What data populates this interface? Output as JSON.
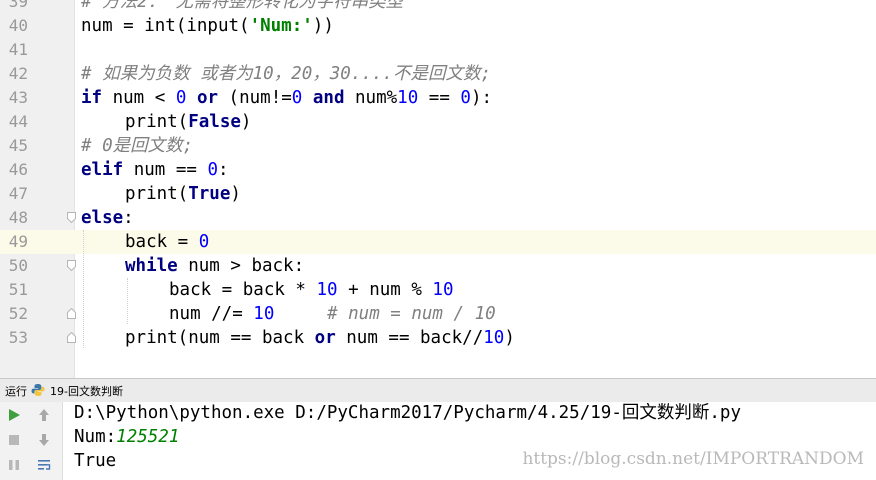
{
  "editor": {
    "lines": [
      {
        "n": "39",
        "fold": "none",
        "ind": 0,
        "segs": [
          [
            "cmt",
            "# 方法2： 无需将整形转化为字符串类型"
          ]
        ]
      },
      {
        "n": "40",
        "fold": "none",
        "ind": 0,
        "segs": [
          [
            "",
            "num = int(input("
          ],
          [
            "str",
            "'Num:'"
          ],
          [
            "",
            "))"
          ]
        ]
      },
      {
        "n": "41",
        "fold": "none",
        "ind": 0,
        "segs": []
      },
      {
        "n": "42",
        "fold": "none",
        "ind": 0,
        "segs": [
          [
            "cmt",
            "# 如果为负数 或者为10，20，30....不是回文数;"
          ]
        ]
      },
      {
        "n": "43",
        "fold": "none",
        "ind": 0,
        "segs": [
          [
            "kw",
            "if"
          ],
          [
            "",
            " num < "
          ],
          [
            "num",
            "0"
          ],
          [
            "",
            " "
          ],
          [
            "kw",
            "or"
          ],
          [
            "",
            " (num!="
          ],
          [
            "num",
            "0"
          ],
          [
            "",
            " "
          ],
          [
            "kw",
            "and"
          ],
          [
            "",
            " num%"
          ],
          [
            "num",
            "10"
          ],
          [
            "",
            " == "
          ],
          [
            "num",
            "0"
          ],
          [
            "",
            "):"
          ]
        ]
      },
      {
        "n": "44",
        "fold": "none",
        "ind": 1,
        "segs": [
          [
            "",
            "print("
          ],
          [
            "kw",
            "False"
          ],
          [
            "",
            ")"
          ]
        ]
      },
      {
        "n": "45",
        "fold": "none",
        "ind": 0,
        "segs": [
          [
            "cmt",
            "# 0是回文数;"
          ]
        ]
      },
      {
        "n": "46",
        "fold": "none",
        "ind": 0,
        "segs": [
          [
            "kw",
            "elif"
          ],
          [
            "",
            " num == "
          ],
          [
            "num",
            "0"
          ],
          [
            "",
            ":"
          ]
        ]
      },
      {
        "n": "47",
        "fold": "none",
        "ind": 1,
        "segs": [
          [
            "",
            "print("
          ],
          [
            "kw",
            "True"
          ],
          [
            "",
            ")"
          ]
        ]
      },
      {
        "n": "48",
        "fold": "open",
        "ind": 0,
        "segs": [
          [
            "kw",
            "else"
          ],
          [
            "",
            ":"
          ]
        ]
      },
      {
        "n": "49",
        "fold": "none",
        "ind": 1,
        "current": true,
        "segs": [
          [
            "",
            "back = "
          ],
          [
            "num",
            "0"
          ]
        ]
      },
      {
        "n": "50",
        "fold": "open",
        "ind": 1,
        "segs": [
          [
            "kw",
            "while"
          ],
          [
            "",
            " num > back:"
          ]
        ]
      },
      {
        "n": "51",
        "fold": "none",
        "ind": 2,
        "segs": [
          [
            "",
            "back = back * "
          ],
          [
            "num",
            "10"
          ],
          [
            "",
            " + num % "
          ],
          [
            "num",
            "10"
          ]
        ]
      },
      {
        "n": "52",
        "fold": "end",
        "ind": 2,
        "segs": [
          [
            "",
            "num //= "
          ],
          [
            "num",
            "10"
          ],
          [
            "",
            "     "
          ],
          [
            "cmt",
            "# num = num / 10"
          ]
        ]
      },
      {
        "n": "53",
        "fold": "end",
        "ind": 1,
        "segs": [
          [
            "",
            "print(num == back "
          ],
          [
            "kw",
            "or"
          ],
          [
            "",
            " num == back//"
          ],
          [
            "num",
            "10"
          ],
          [
            "",
            ")"
          ]
        ]
      }
    ]
  },
  "run_bar": {
    "label": "运行",
    "tab_name": "19-回文数判断"
  },
  "console": {
    "command": "D:\\Python\\python.exe D:/PyCharm2017/Pycharm/4.25/19-回文数判断.py",
    "prompt": "Num:",
    "input": "125521",
    "result": "True"
  },
  "watermark": "https://blog.csdn.net/IMPORTRANDOM",
  "colors": {
    "keyword": "#000080",
    "number": "#0000ff",
    "string": "#008000",
    "comment": "#808080",
    "current_line": "#fcfae8",
    "run_icon": "#3e9f3e"
  }
}
